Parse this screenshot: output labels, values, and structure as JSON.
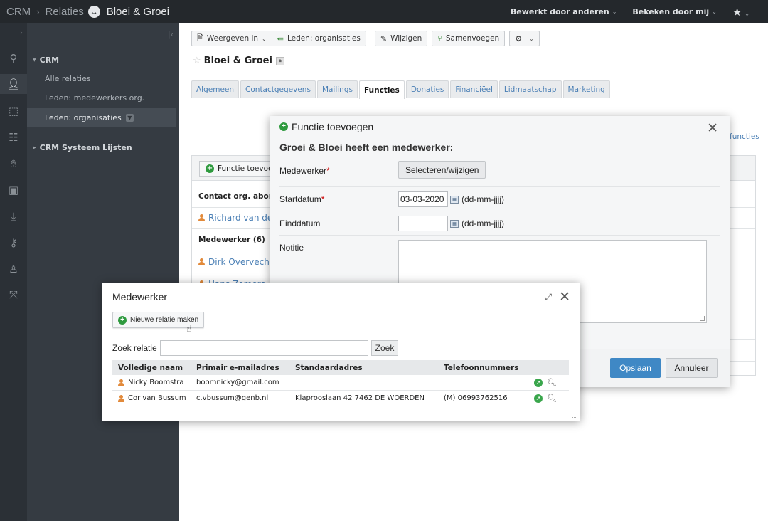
{
  "topbar": {
    "app": "CRM",
    "section": "Relaties",
    "entity": "Bloei & Groei",
    "edited_by_others": "Bewerkt door anderen",
    "viewed_by_me": "Bekeken door mij"
  },
  "nav": {
    "section_crm": "CRM",
    "items": [
      {
        "label": "Alle relaties"
      },
      {
        "label": "Leden: medewerkers org."
      },
      {
        "label": "Leden: organisaties"
      }
    ],
    "section_system": "CRM Systeem Lijsten"
  },
  "toolbar": {
    "view_in": "Weergeven in",
    "members_orgs": "Leden: organisaties",
    "edit": "Wijzigen",
    "merge": "Samenvoegen"
  },
  "page": {
    "title": "Bloei & Groei",
    "tabs": [
      "Algemeen",
      "Contactgegevens",
      "Mailings",
      "Functies",
      "Donaties",
      "Financiëel",
      "Lidmaatschap",
      "Marketing"
    ],
    "active_tab": "Functies"
  },
  "background": {
    "side_link": "functies",
    "add_function_btn": "Functie toevoeg",
    "rows": [
      {
        "type": "label",
        "text": "Contact org. abonn"
      },
      {
        "type": "link",
        "text": "Richard van der"
      },
      {
        "type": "label",
        "text": "Medewerker (6)"
      },
      {
        "type": "link",
        "text": "Dirk Overvecht"
      },
      {
        "type": "link",
        "text": "Hans Zomers"
      }
    ]
  },
  "dialog_function": {
    "title": "Functie toevoegen",
    "subtitle": "Groei & Bloei heeft een medewerker:",
    "employee_label": "Medewerker",
    "select_btn": "Selecteren/wijzigen",
    "start_label": "Startdatum",
    "start_value": "03-03-2020",
    "date_format": "(dd-mm-jjjj)",
    "end_label": "Einddatum",
    "end_value": "",
    "note_label": "Notitie",
    "save": "Opslaan",
    "cancel": "Annuleer",
    "cancel_underline": "A",
    "cancel_rest": "nnuleer"
  },
  "dialog_employee": {
    "title": "Medewerker",
    "new_relation": "Nieuwe relatie maken",
    "search_label": "Zoek relatie",
    "search_value": "",
    "search_btn": "Zoek",
    "columns": [
      "Volledige naam",
      "Primair e-mailadres",
      "Standaardadres",
      "Telefoonnummers"
    ],
    "rows": [
      {
        "name": "Nicky Boomstra",
        "email": "boomnicky@gmail.com",
        "address": "",
        "phone": ""
      },
      {
        "name": "Cor van Bussum",
        "email": "c.vbussum@genb.nl",
        "address": "Klaprooslaan 42 7462 DE WOERDEN",
        "phone": "(M) 06993762516"
      }
    ]
  }
}
